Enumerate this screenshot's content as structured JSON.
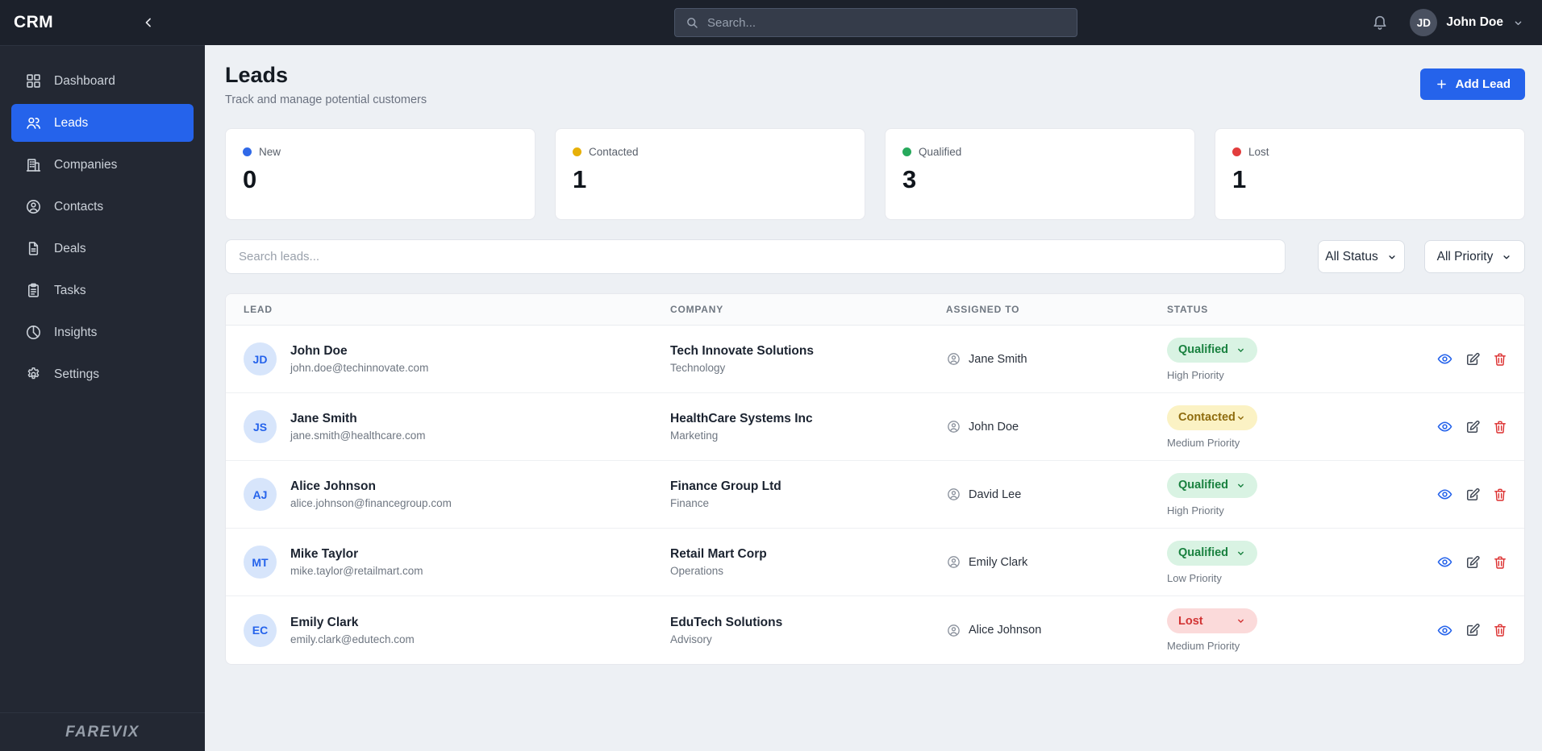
{
  "topbar": {
    "brand": "CRM",
    "search_placeholder": "Search...",
    "user_initials": "JD",
    "user_name": "John Doe"
  },
  "sidebar": {
    "items": [
      {
        "label": "Dashboard",
        "icon": "dashboard-icon",
        "active": false
      },
      {
        "label": "Leads",
        "icon": "leads-icon",
        "active": true
      },
      {
        "label": "Companies",
        "icon": "companies-icon",
        "active": false
      },
      {
        "label": "Contacts",
        "icon": "contacts-icon",
        "active": false
      },
      {
        "label": "Deals",
        "icon": "deals-icon",
        "active": false
      },
      {
        "label": "Tasks",
        "icon": "tasks-icon",
        "active": false
      },
      {
        "label": "Insights",
        "icon": "insights-icon",
        "active": false
      },
      {
        "label": "Settings",
        "icon": "settings-icon",
        "active": false
      }
    ],
    "footer_brand": "FAREVIX"
  },
  "page_header": {
    "title": "Leads",
    "subtitle": "Track and manage potential customers",
    "add_lead_button": "Add Lead"
  },
  "stat_cards": [
    {
      "label": "New",
      "value": "0",
      "dot_color": "#3069e8"
    },
    {
      "label": "Contacted",
      "value": "1",
      "dot_color": "#e7b008"
    },
    {
      "label": "Qualified",
      "value": "3",
      "dot_color": "#27a95c"
    },
    {
      "label": "Lost",
      "value": "1",
      "dot_color": "#e23d3d"
    }
  ],
  "filters": {
    "search_placeholder": "Search leads...",
    "status_select": "All Status",
    "priority_select": "All Priority"
  },
  "table": {
    "headers": {
      "lead": "LEAD",
      "company": "COMPANY",
      "assigned": "ASSIGNED TO",
      "status": "STATUS"
    },
    "rows": [
      {
        "initials": "JD",
        "name": "John Doe",
        "email": "john.doe@techinnovate.com",
        "company": "Tech Innovate Solutions",
        "industry": "Technology",
        "assigned_to": "Jane Smith",
        "status": "Qualified",
        "status_key": "qualified",
        "priority": "High Priority"
      },
      {
        "initials": "JS",
        "name": "Jane Smith",
        "email": "jane.smith@healthcare.com",
        "company": "HealthCare Systems Inc",
        "industry": "Marketing",
        "assigned_to": "John Doe",
        "status": "Contacted",
        "status_key": "contacted",
        "priority": "Medium Priority"
      },
      {
        "initials": "AJ",
        "name": "Alice Johnson",
        "email": "alice.johnson@financegroup.com",
        "company": "Finance Group Ltd",
        "industry": "Finance",
        "assigned_to": "David Lee",
        "status": "Qualified",
        "status_key": "qualified",
        "priority": "High Priority"
      },
      {
        "initials": "MT",
        "name": "Mike Taylor",
        "email": "mike.taylor@retailmart.com",
        "company": "Retail Mart Corp",
        "industry": "Operations",
        "assigned_to": "Emily Clark",
        "status": "Qualified",
        "status_key": "qualified",
        "priority": "Low Priority"
      },
      {
        "initials": "EC",
        "name": "Emily Clark",
        "email": "emily.clark@edutech.com",
        "company": "EduTech Solutions",
        "industry": "Advisory",
        "assigned_to": "Alice Johnson",
        "status": "Lost",
        "status_key": "lost",
        "priority": "Medium Priority"
      }
    ]
  },
  "colors": {
    "accent_blue": "#2563eb",
    "topbar_bg": "#1c212b",
    "sidebar_bg": "#232833",
    "page_bg": "#edf0f4",
    "status_qualified_bg": "#d9f3e3",
    "status_qualified_text": "#19813f",
    "status_contacted_bg": "#fbf2c4",
    "status_contacted_text": "#8f6c0e",
    "status_lost_bg": "#fbdada",
    "status_lost_text": "#d23434",
    "dot_new": "#3069e8",
    "dot_contacted": "#e7b008",
    "dot_qualified": "#27a95c",
    "dot_lost": "#e23d3d"
  }
}
